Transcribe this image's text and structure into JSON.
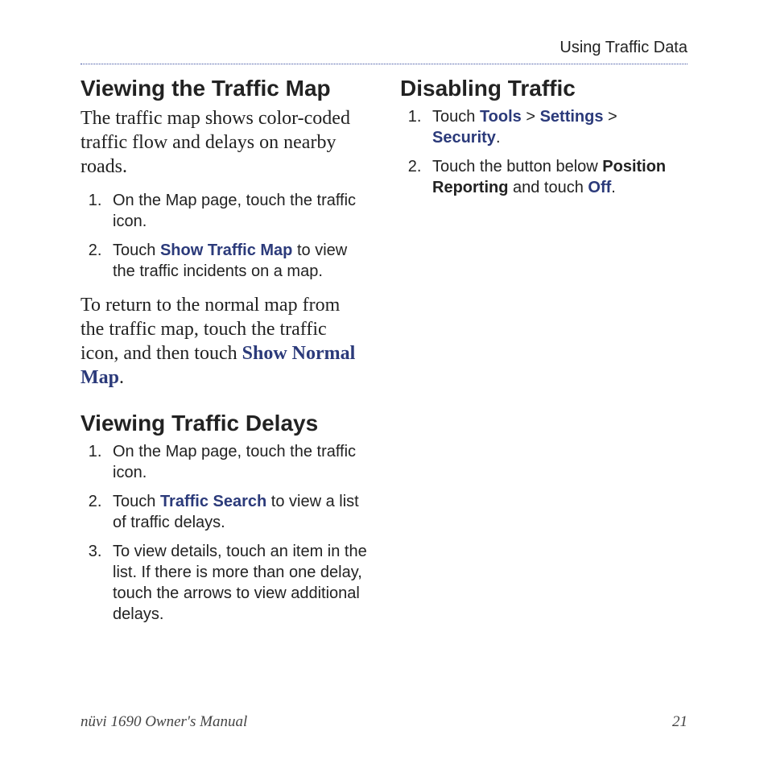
{
  "header": {
    "section_title": "Using Traffic Data"
  },
  "left": {
    "h1": "Viewing the Traffic Map",
    "intro": "The traffic map shows color-coded traffic flow and delays on nearby roads.",
    "steps1": {
      "s1": "On the Map page, touch the traffic icon.",
      "s2_pre": "Touch ",
      "s2_link": "Show Traffic Map",
      "s2_post": " to view the traffic incidents on a map."
    },
    "return_pre": "To return to the normal map from the traffic map, touch the traffic icon, and then touch ",
    "return_link": "Show Normal Map",
    "return_post": ".",
    "h2": "Viewing Traffic Delays",
    "steps2": {
      "s1": "On the Map page, touch the traffic icon.",
      "s2_pre": "Touch ",
      "s2_link": "Traffic Search",
      "s2_post": " to view a list of traffic delays.",
      "s3": "To view details, touch an item in the list. If there is more than one delay, touch the arrows to view additional delays."
    }
  },
  "right": {
    "h1": "Disabling Traffic",
    "steps": {
      "s1_pre": "Touch ",
      "s1_link1": "Tools",
      "s1_sep1": " > ",
      "s1_link2": "Settings",
      "s1_sep2": " > ",
      "s1_link3": "Security",
      "s1_post": ".",
      "s2_pre": "Touch the button below ",
      "s2_bold": "Position Reporting",
      "s2_mid": " and touch ",
      "s2_link": "Off",
      "s2_post": "."
    }
  },
  "footer": {
    "manual": "nüvi 1690 Owner's Manual",
    "page": "21"
  }
}
